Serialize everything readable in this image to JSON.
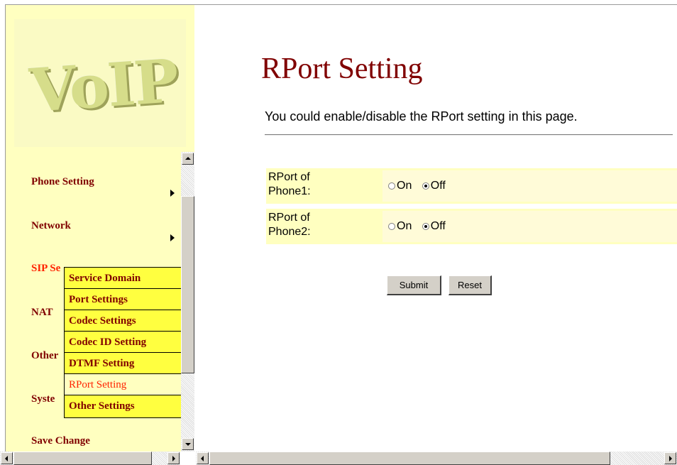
{
  "logo": {
    "text": "VoIP"
  },
  "nav": {
    "items": [
      {
        "label": "Phone Setting",
        "has_submenu": true
      },
      {
        "label": "Network",
        "has_submenu": true
      },
      {
        "label": "SIP Setting",
        "visible_text": "SIP Se",
        "active": true
      },
      {
        "label": "NAT Traversal",
        "visible_text": "NAT"
      },
      {
        "label": "Other Settings",
        "visible_text": "Other"
      },
      {
        "label": "System",
        "visible_text": "Syste"
      },
      {
        "label": "Save Change"
      }
    ],
    "submenu": [
      {
        "label": "Service Domain"
      },
      {
        "label": "Port Settings"
      },
      {
        "label": "Codec Settings"
      },
      {
        "label": "Codec ID Setting"
      },
      {
        "label": "DTMF Setting"
      },
      {
        "label": "RPort Setting",
        "active": true
      },
      {
        "label": "Other Settings"
      }
    ]
  },
  "main": {
    "title": "RPort Setting",
    "description": "You could enable/disable the RPort setting in this page.",
    "rows": [
      {
        "label_line1": "RPort of",
        "label_line2": "Phone1:",
        "on_label": "On",
        "off_label": "Off",
        "selected": "Off"
      },
      {
        "label_line1": "RPort of",
        "label_line2": "Phone2:",
        "on_label": "On",
        "off_label": "Off",
        "selected": "Off"
      }
    ],
    "buttons": {
      "submit": "Submit",
      "reset": "Reset"
    }
  },
  "colors": {
    "nav_bg": "#ffffc0",
    "submenu_bg": "#ffff40",
    "heading": "#800000",
    "active": "#ff2200",
    "row_bg": "#ffffc0",
    "button_face": "#d4d0c8"
  }
}
